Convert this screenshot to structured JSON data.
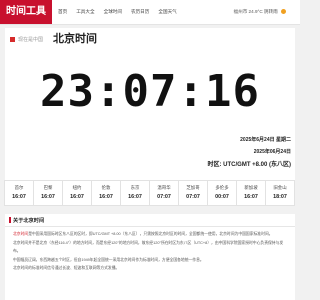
{
  "header": {
    "logo": "时间工具",
    "nav": [
      "首页",
      "工具大全",
      "全球时间",
      "农历日历",
      "全国天气"
    ],
    "weather": "福州市 24.9°C 阴转雨"
  },
  "breadcrumb": {
    "prefix": "现在是中国",
    "title": "北京时间"
  },
  "clock": {
    "time": "23:07:16"
  },
  "date_info": {
    "date_weekday": "2025年6月24日 星期二",
    "lunar": "2025年06月24日",
    "timezone": "时区: UTC/GMT +8.00 (东八区)"
  },
  "cities": [
    {
      "name": "首尔",
      "time": "16:07"
    },
    {
      "name": "巴黎",
      "time": "16:07"
    },
    {
      "name": "纽约",
      "time": "16:07"
    },
    {
      "name": "伦敦",
      "time": "16:07"
    },
    {
      "name": "东京",
      "time": "16:07"
    },
    {
      "name": "温哥华",
      "time": "07:07"
    },
    {
      "name": "芝加哥",
      "time": "07:07"
    },
    {
      "name": "多伦多",
      "time": "00:07"
    },
    {
      "name": "新加坡",
      "time": "16:07"
    },
    {
      "name": "旧金山",
      "time": "18:07"
    }
  ],
  "about": {
    "heading": "关于北京时间",
    "p1_red": "北京时间",
    "p1": "是中国采用国际时区东八区的区时，即UTC/GMT +8.00（东八区），只需按照北京时区的时间，全国都统一使用，北京时间为中国国家标准时间。",
    "p2": "北京时间并不是北京（东经116.4°）的地方时间，而是东经120°的地方时间，故东经120°所在时区为东八区（UTC+8），由中国科学院国家授时中心负责保持与发布。",
    "p3": "中国幅员辽阔，东西跨越五个时区，但自1949年起全国统一采用北京时间作为标准时间，方便全国各地统一作息。",
    "p4": "北京时间的标准时间信号通过长波、短波和互联网等方式发播。"
  }
}
